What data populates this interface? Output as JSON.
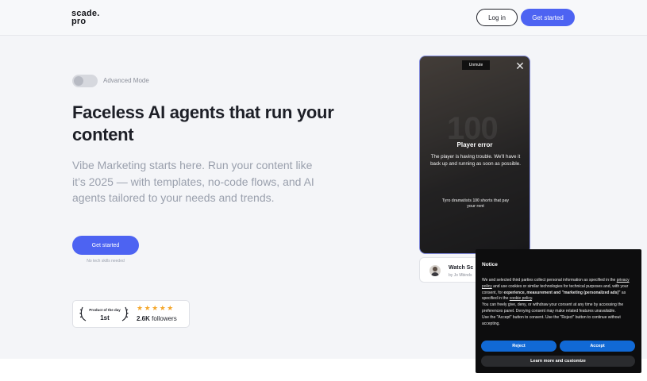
{
  "header": {
    "logo_line1": "scade.",
    "logo_line2": "pro",
    "login_label": "Log in",
    "get_started_label": "Get started"
  },
  "hero": {
    "toggle_label": "Advanced Mode",
    "toggle_on": false,
    "title": "Faceless AI agents that run your content",
    "subtitle": "Vibe Marketing starts here. Run your content like it’s 2025 — with templates, no-code flows, and AI agents tailored to your needs and trends.",
    "cta_label": "Get started",
    "cta_note": "No tech skills needed"
  },
  "badge": {
    "top_text": "Product of the day",
    "rank": "1st",
    "stars": "★★★★★",
    "followers_count": "2.6K",
    "followers_label": "followers"
  },
  "video": {
    "unmute_label": "Unmute",
    "close_icon": "close-icon",
    "background_text": "100",
    "error_title": "Player error",
    "error_body": "The player is having trouble. We'll have it back up and running as soon as possible.",
    "caption": "Tyro dramatists 100 shorts that pay your rent"
  },
  "watch_card": {
    "title": "Watch Sc",
    "byline": "by Jo Mbinds"
  },
  "notice": {
    "title": "Notice",
    "body_1": "We and selected third parties collect personal information as specified in the ",
    "link_privacy": "privacy policy",
    "body_2": " and use cookies or similar technologies for technical purposes and, with your consent, for ",
    "body_bold": "experience, measurement and \"marketing (personalized ads)\"",
    "body_3": " as specified in the ",
    "link_cookie": "cookie policy",
    "body_4": ".",
    "body_5": "You can freely give, deny, or withdraw your consent at any time by accessing the preferences panel. Denying consent may make related features unavailable.",
    "body_6": "Use the \"Accept\" button to consent. Use the \"Reject\" button to continue without accepting.",
    "reject_label": "Reject",
    "accept_label": "Accept",
    "learn_label": "Learn more and customize"
  },
  "colors": {
    "accent": "#4d63f2",
    "notice_button": "#1169d5",
    "star": "#f4a62a"
  }
}
